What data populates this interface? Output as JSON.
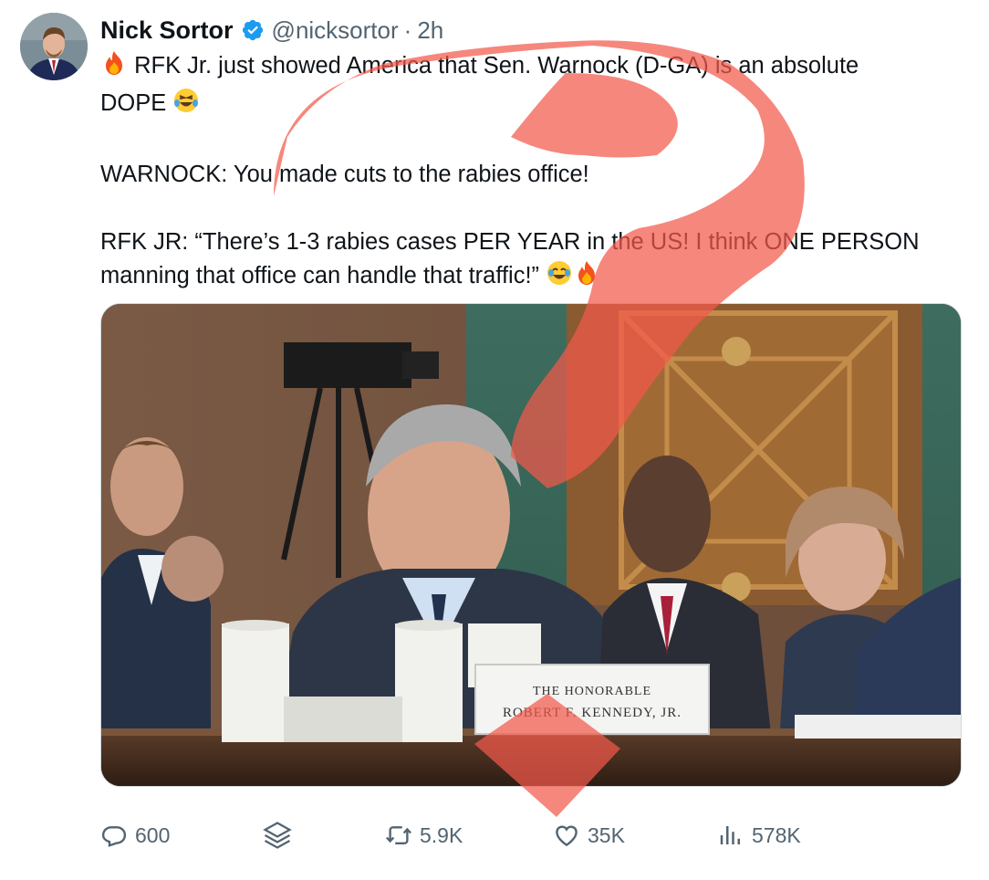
{
  "author": {
    "name": "Nick Sortor",
    "handle": "@nicksortor",
    "separator": "·",
    "time": "2h"
  },
  "tweet": {
    "line1": "RFK Jr. just showed America that Sen. Warnock (D-GA) is an absolute",
    "line2": "DOPE",
    "para2": "WARNOCK: You made cuts to the rabies office!",
    "para3": "RFK JR: “There’s 1-3 rabies cases PER YEAR in the US! I think ONE PERSON manning that office can handle that traffic!”"
  },
  "media": {
    "nameplate_line1": "The Honorable",
    "nameplate_line2": "Robert F. Kennedy, Jr."
  },
  "actions": {
    "replies": "600",
    "retweets": "5.9K",
    "likes": "35K",
    "views": "578K"
  },
  "icons": {
    "verified": "verified-badge-icon",
    "fire": "fire-emoji",
    "rofl": "rolling-laughing-emoji",
    "joy": "tears-of-joy-emoji",
    "reply": "reply-icon",
    "grok": "layers-icon",
    "retweet": "retweet-icon",
    "like": "heart-icon",
    "views": "views-icon"
  },
  "colors": {
    "verified_blue": "#1d9bf0",
    "secondary_text": "#536471",
    "annotation_red": "#f2594b"
  }
}
